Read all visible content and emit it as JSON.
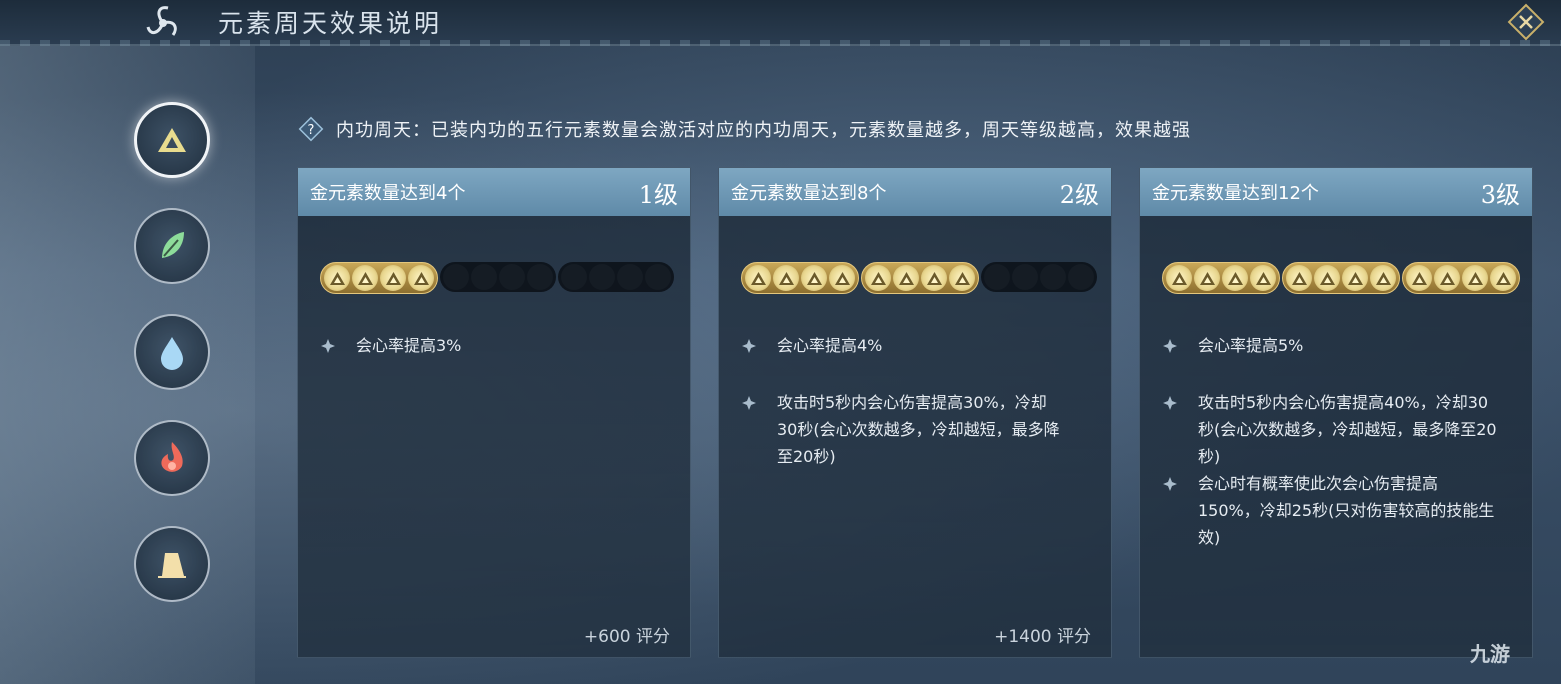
{
  "window": {
    "title": "元素周天效果说明"
  },
  "elements": [
    {
      "name": "metal",
      "icon": "metal-triangle-icon",
      "active": true,
      "color": "#e9dc8e"
    },
    {
      "name": "wood",
      "icon": "leaf-icon",
      "active": false,
      "color": "#8ddc9a"
    },
    {
      "name": "water",
      "icon": "water-drop-icon",
      "active": false,
      "color": "#9fd1f2"
    },
    {
      "name": "fire",
      "icon": "flame-icon",
      "active": false,
      "color": "#ef6a5a"
    },
    {
      "name": "earth",
      "icon": "rock-icon",
      "active": false,
      "color": "#f3dfaa"
    }
  ],
  "info": {
    "text": "内功周天：已装内功的五行元素数量会激活对应的内功周天，元素数量越多，周天等级越高，效果越强"
  },
  "cards": [
    {
      "condition": "金元素数量达到4个",
      "level": "1级",
      "active_count": 4,
      "total": 12,
      "effects": [
        "会心率提高3%"
      ],
      "score": "+600 评分"
    },
    {
      "condition": "金元素数量达到8个",
      "level": "2级",
      "active_count": 8,
      "total": 12,
      "effects": [
        "会心率提高4%",
        "攻击时5秒内会心伤害提高30%，冷却30秒(会心次数越多，冷却越短，最多降至20秒)"
      ],
      "score": "+1400 评分"
    },
    {
      "condition": "金元素数量达到12个",
      "level": "3级",
      "active_count": 12,
      "total": 12,
      "effects": [
        "会心率提高5%",
        "攻击时5秒内会心伤害提高40%，冷却30秒(会心次数越多，冷却越短，最多降至20秒)",
        "会心时有概率使此次会心伤害提高150%，冷却25秒(只对伤害较高的技能生效)"
      ],
      "score": ""
    }
  ],
  "watermark": "九游",
  "colors": {
    "header": "#6f98b5",
    "gold": "#c9a858",
    "panel": "#1f3040"
  }
}
